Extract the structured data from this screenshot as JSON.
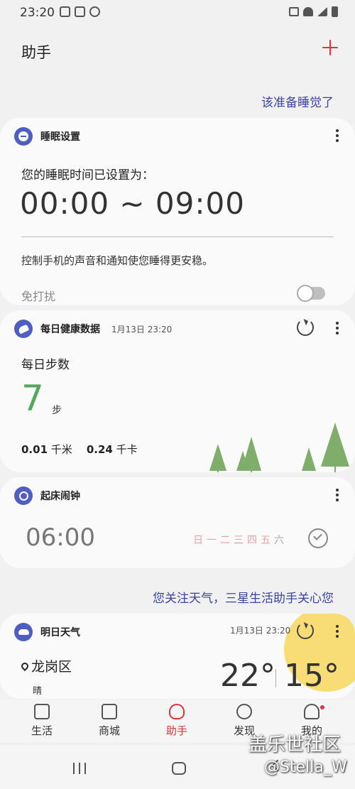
{
  "status_bar": {
    "time": "23:20"
  },
  "header": {
    "title": "助手",
    "add_icon": "plus-icon"
  },
  "captions": {
    "sleep": "该准备睡觉了",
    "weather": "您关注天气，三星生活助手关心您"
  },
  "sleep_card": {
    "title": "睡眠设置",
    "label": "您的睡眠时间已设置为：",
    "range": "00:00 ~ 09:00",
    "description": "控制手机的声音和通知使您睡得更安稳。",
    "dnd_label": "免打扰",
    "dnd_enabled": false
  },
  "health_card": {
    "title": "每日健康数据",
    "time": "1月13日 23:20",
    "steps_label": "每日步数",
    "steps_value": "7",
    "steps_unit": "步",
    "distance_value": "0.01",
    "distance_unit": "千米",
    "calories_value": "0.24",
    "calories_unit": "千卡"
  },
  "alarm_card": {
    "title": "起床闹钟",
    "time": "06:00",
    "days": [
      {
        "label": "日",
        "color": "#e8a0a8"
      },
      {
        "label": "一",
        "color": "#e8a0a8"
      },
      {
        "label": "二",
        "color": "#e8a0a8"
      },
      {
        "label": "三",
        "color": "#e8a0a8"
      },
      {
        "label": "四",
        "color": "#e8a0a8"
      },
      {
        "label": "五",
        "color": "#e8a0a8"
      },
      {
        "label": "六",
        "color": "#aaaaaa"
      }
    ]
  },
  "weather_card": {
    "title": "明日天气",
    "time": "1月13日 23:20",
    "location": "龙岗区",
    "condition": "晴",
    "temp_high": "22°",
    "temp_low": "15°"
  },
  "bottom_nav": [
    {
      "label": "生活",
      "icon": "bookmark-icon",
      "active": false
    },
    {
      "label": "商城",
      "icon": "bag-icon",
      "active": false
    },
    {
      "label": "助手",
      "icon": "heart-icon",
      "active": true
    },
    {
      "label": "发现",
      "icon": "compass-icon",
      "active": false
    },
    {
      "label": "我的",
      "icon": "person-icon",
      "active": false
    }
  ],
  "watermark": {
    "line1": "盖乐世社区",
    "line2": "@Stella_W"
  },
  "colors": {
    "accent": "#e0343d",
    "caption": "#3b43a5",
    "steps": "#4fab5a",
    "card_icon": "#4e5ec2",
    "sun": "#f8d655"
  }
}
